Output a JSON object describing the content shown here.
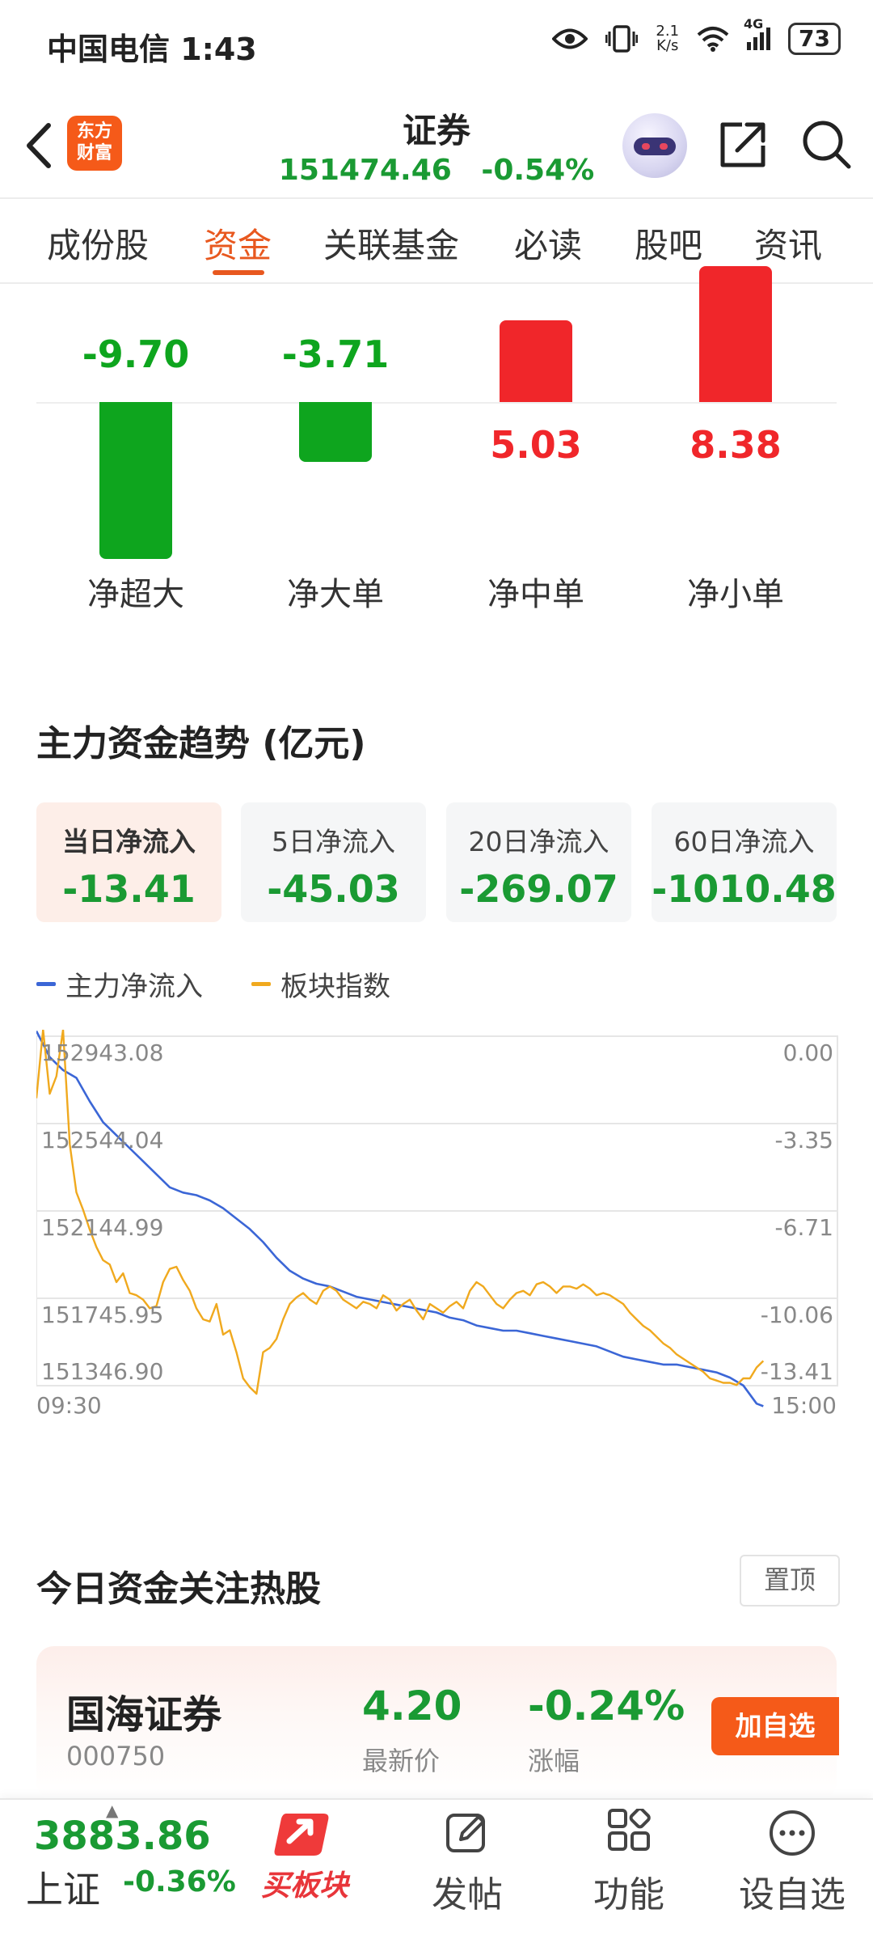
{
  "status_bar": {
    "carrier_time": "中国电信 1:43",
    "net_speed_value": "2.1",
    "net_speed_unit": "K/s",
    "network": "4G",
    "battery": "73"
  },
  "header": {
    "logo_line1": "东方",
    "logo_line2": "财富",
    "title": "证券",
    "index_value": "151474.46",
    "index_change": "-0.54%"
  },
  "tabs": [
    "成份股",
    "资金",
    "关联基金",
    "必读",
    "股吧",
    "资讯"
  ],
  "active_tab": 1,
  "order_flow": {
    "items": [
      {
        "label": "净超大",
        "value": "-9.70",
        "num": -9.7
      },
      {
        "label": "净大单",
        "value": "-3.71",
        "num": -3.71
      },
      {
        "label": "净中单",
        "value": "5.03",
        "num": 5.03
      },
      {
        "label": "净小单",
        "value": "8.38",
        "num": 8.38
      }
    ],
    "positive_color": "#f0262a",
    "negative_color": "#0ea51e"
  },
  "trend": {
    "title": "主力资金趋势 (亿元)",
    "cards": [
      {
        "label": "当日净流入",
        "value": "-13.41"
      },
      {
        "label": "5日净流入",
        "value": "-45.03"
      },
      {
        "label": "20日净流入",
        "value": "-269.07"
      },
      {
        "label": "60日净流入",
        "value": "-1010.48"
      }
    ],
    "legend": [
      {
        "name": "主力净流入",
        "color": "#3b66d6"
      },
      {
        "name": "板块指数",
        "color": "#f0a91e"
      }
    ]
  },
  "chart_data": {
    "type": "line",
    "left_axis_ticks": [
      "152943.08",
      "152544.04",
      "152144.99",
      "151745.95",
      "151346.90"
    ],
    "right_axis_ticks": [
      "0.00",
      "-3.35",
      "-6.71",
      "-10.06",
      "-13.41"
    ],
    "x_tick_labels": [
      "09:30",
      "15:00"
    ],
    "left_ylim": [
      151346.9,
      152943.08
    ],
    "right_ylim": [
      -13.41,
      0.0
    ],
    "xlim": [
      0,
      240
    ],
    "series": [
      {
        "name": "主力净流入",
        "axis": "right",
        "color": "#3b66d6",
        "x": [
          0,
          4,
          8,
          12,
          16,
          20,
          24,
          28,
          32,
          36,
          40,
          44,
          48,
          52,
          56,
          60,
          64,
          68,
          72,
          76,
          80,
          84,
          88,
          92,
          96,
          100,
          104,
          108,
          112,
          116,
          120,
          124,
          128,
          132,
          136,
          140,
          144,
          148,
          152,
          156,
          160,
          164,
          168,
          172,
          176,
          180,
          184,
          188,
          192,
          196,
          200,
          204,
          208,
          212,
          216,
          218
        ],
        "y": [
          0.2,
          -0.8,
          -1.3,
          -1.6,
          -2.5,
          -3.3,
          -3.8,
          -4.3,
          -4.8,
          -5.3,
          -5.8,
          -6.0,
          -6.1,
          -6.3,
          -6.6,
          -7.0,
          -7.4,
          -7.9,
          -8.5,
          -9.0,
          -9.3,
          -9.5,
          -9.6,
          -9.8,
          -10.0,
          -10.1,
          -10.2,
          -10.3,
          -10.4,
          -10.5,
          -10.6,
          -10.8,
          -10.9,
          -11.1,
          -11.2,
          -11.3,
          -11.3,
          -11.4,
          -11.5,
          -11.6,
          -11.7,
          -11.8,
          -11.9,
          -12.1,
          -12.3,
          -12.4,
          -12.5,
          -12.6,
          -12.6,
          -12.7,
          -12.8,
          -12.9,
          -13.1,
          -13.4,
          -14.1,
          -14.2
        ]
      },
      {
        "name": "板块指数",
        "axis": "left",
        "color": "#f0a91e",
        "x": [
          0,
          2,
          4,
          6,
          8,
          10,
          12,
          14,
          16,
          18,
          20,
          22,
          24,
          26,
          28,
          30,
          32,
          34,
          36,
          38,
          40,
          42,
          44,
          46,
          48,
          50,
          52,
          54,
          56,
          58,
          60,
          62,
          64,
          66,
          68,
          70,
          72,
          74,
          76,
          78,
          80,
          82,
          84,
          86,
          88,
          90,
          92,
          94,
          96,
          98,
          100,
          102,
          104,
          106,
          108,
          110,
          112,
          114,
          116,
          118,
          120,
          122,
          124,
          126,
          128,
          130,
          132,
          134,
          136,
          138,
          140,
          142,
          144,
          146,
          148,
          150,
          152,
          154,
          156,
          158,
          160,
          162,
          164,
          166,
          168,
          170,
          172,
          174,
          176,
          178,
          180,
          182,
          184,
          186,
          188,
          190,
          192,
          194,
          196,
          198,
          200,
          202,
          204,
          206,
          208,
          210,
          212,
          214,
          216,
          218
        ],
        "y": [
          152660,
          152990,
          152680,
          152760,
          152982,
          152450,
          152230,
          152150,
          152060,
          151980,
          151920,
          151900,
          151820,
          151860,
          151770,
          151760,
          151740,
          151700,
          151710,
          151820,
          151880,
          151890,
          151830,
          151780,
          151700,
          151650,
          151640,
          151720,
          151580,
          151600,
          151500,
          151380,
          151340,
          151310,
          151500,
          151520,
          151560,
          151650,
          151720,
          151750,
          151770,
          151740,
          151720,
          151780,
          151800,
          151780,
          151740,
          151720,
          151700,
          151730,
          151720,
          151700,
          151760,
          151740,
          151690,
          151720,
          151740,
          151690,
          151650,
          151720,
          151700,
          151680,
          151710,
          151730,
          151700,
          151780,
          151820,
          151800,
          151760,
          151720,
          151700,
          151740,
          151770,
          151780,
          151760,
          151810,
          151820,
          151800,
          151770,
          151800,
          151800,
          151790,
          151810,
          151790,
          151760,
          151770,
          151760,
          151740,
          151720,
          151680,
          151650,
          151620,
          151600,
          151570,
          151540,
          151520,
          151490,
          151470,
          151450,
          151430,
          151410,
          151380,
          151370,
          151360,
          151360,
          151350,
          151380,
          151380,
          151430,
          151460
        ]
      }
    ]
  },
  "hot_stocks": {
    "title": "今日资金关注热股",
    "pin_label": "置顶",
    "stock": {
      "name": "国海证券",
      "code": "000750",
      "price": "4.20",
      "price_label": "最新价",
      "change": "-0.24%",
      "change_label": "涨幅",
      "add_label": "加自选"
    }
  },
  "bottom_nav": {
    "index_value": "3883.86",
    "index_name": "上证",
    "index_change": "-0.36%",
    "items": [
      {
        "label": "买板块",
        "icon": "buy-sector-icon"
      },
      {
        "label": "发帖",
        "icon": "edit-icon"
      },
      {
        "label": "功能",
        "icon": "grid-icon"
      },
      {
        "label": "设自选",
        "icon": "more-icon"
      }
    ]
  }
}
